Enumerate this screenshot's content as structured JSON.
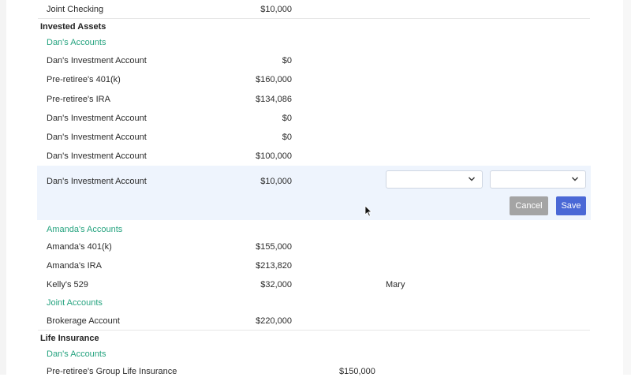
{
  "rows_top": [
    {
      "name": "Joint Checking",
      "value": "$10,000"
    }
  ],
  "invested_assets": {
    "title": "Invested Assets",
    "dans_group": "Dan's Accounts",
    "dans_rows": [
      {
        "name": "Dan's Investment Account",
        "value": "$0"
      },
      {
        "name": "Pre-retiree's 401(k)",
        "value": "$160,000"
      },
      {
        "name": "Pre-retiree's IRA",
        "value": "$134,086"
      },
      {
        "name": "Dan's Investment Account",
        "value": "$0"
      },
      {
        "name": "Dan's Investment Account",
        "value": "$0"
      },
      {
        "name": "Dan's Investment Account",
        "value": "$100,000"
      }
    ],
    "editing_row": {
      "name": "Dan's Investment Account",
      "value": "$10,000"
    },
    "amandas_group": "Amanda's Accounts",
    "amandas_rows": [
      {
        "name": "Amanda's 401(k)",
        "value": "$155,000",
        "extra": ""
      },
      {
        "name": "Amanda's IRA",
        "value": "$213,820",
        "extra": ""
      },
      {
        "name": "Kelly's 529",
        "value": "$32,000",
        "extra": "Mary"
      }
    ],
    "joint_group": "Joint Accounts",
    "joint_rows": [
      {
        "name": "Brokerage Account",
        "value": "$220,000"
      }
    ]
  },
  "life_insurance": {
    "title": "Life Insurance",
    "dans_group": "Dan's Accounts",
    "rows": [
      {
        "name": "Pre-retiree's Group Life Insurance",
        "value": "$150,000"
      }
    ]
  },
  "edit_actions": {
    "cancel_label": "Cancel",
    "save_label": "Save"
  },
  "colors": {
    "accent_green": "#25a37f",
    "save_blue": "#4a68d6",
    "cancel_gray": "#a4a4a4",
    "edit_bg": "#eef4fd"
  }
}
